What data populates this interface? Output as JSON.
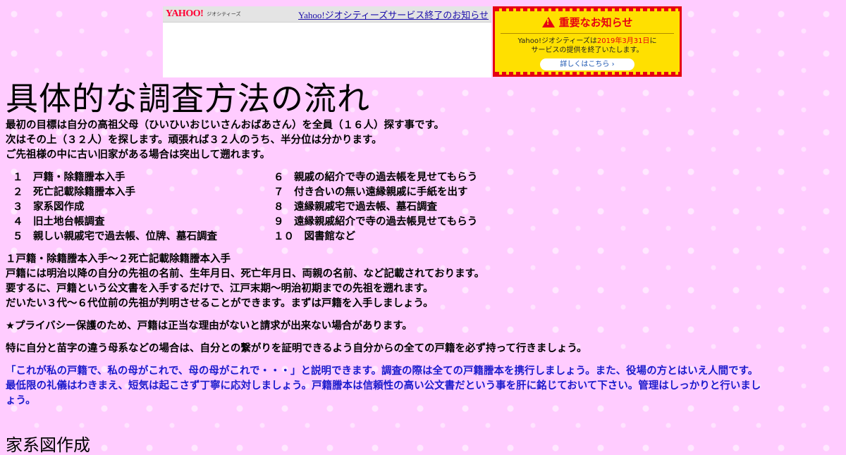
{
  "topbar": {
    "logo": "YAHOO!",
    "logo_sub": "ジオシティーズ",
    "link": "Yahoo!ジオシティーズサービス終了のお知らせ"
  },
  "notice": {
    "title": "重要なお知らせ",
    "body_prefix": "Yahoo!ジオシティーズは",
    "body_date": "2019年3月31日",
    "body_suffix": "に",
    "body_line2": "サービスの提供を終了いたします。",
    "button": "詳しくはこちら ›"
  },
  "page": {
    "title": "具体的な調査方法の流れ",
    "intro": [
      "最初の目標は自分の高祖父母（ひいひいおじいさんおばあさん）を全員（１６人）探す事です。",
      "次はその上（３２人）を探します。頑張れば３２人のうち、半分位は分かります。",
      "ご先祖様の中に古い旧家がある場合は突出して遡れます。"
    ],
    "steps_left": [
      "１　戸籍・除籍謄本入手",
      "２　死亡記載除籍謄本入手",
      "３　家系図作成",
      "４　旧土地台帳調査",
      "５　親しい親戚宅で過去帳、位牌、墓石調査"
    ],
    "steps_right": [
      "６　親戚の紹介で寺の過去帳を見せてもらう",
      "７　付き合いの無い遠縁親戚に手紙を出す",
      "８　遠縁親戚宅で過去帳、墓石調査",
      "９　遠縁親戚紹介で寺の過去帳見せてもらう",
      "１０　図書館など"
    ],
    "section1": [
      "１戸籍・除籍謄本入手～２死亡記載除籍謄本入手",
      "戸籍には明治以降の自分の先祖の名前、生年月日、死亡年月日、両親の名前、など記載されております。",
      "要するに、戸籍という公文書を入手するだけで、江戸末期～明治初期までの先祖を遡れます。",
      "だいたい３代～６代位前の先祖が判明させることができます。まずは戸籍を入手しましょう。"
    ],
    "privacy": "★プライバシー保護のため、戸籍は正当な理由がないと請求が出来ない場合があります。",
    "maternal": "特に自分と苗字の違う母系などの場合は、自分との繋がりを証明できるよう自分からの全ての戸籍を必ず持って行きましょう。",
    "blue_note": [
      "「これが私の戸籍で、私の母がこれで、母の母がこれで・・・」と説明できます。調査の際は全ての戸籍謄本を携行しましょう。また、役場の方とはいえ人間です。",
      "最低限の礼儀はわきまえ、短気は起こさず丁寧に応対しましょう。戸籍謄本は信頼性の高い公文書だという事を肝に銘じておいて下さい。管理はしっかりと行いまし",
      "ょう。"
    ],
    "next_heading": "家系図作成"
  }
}
